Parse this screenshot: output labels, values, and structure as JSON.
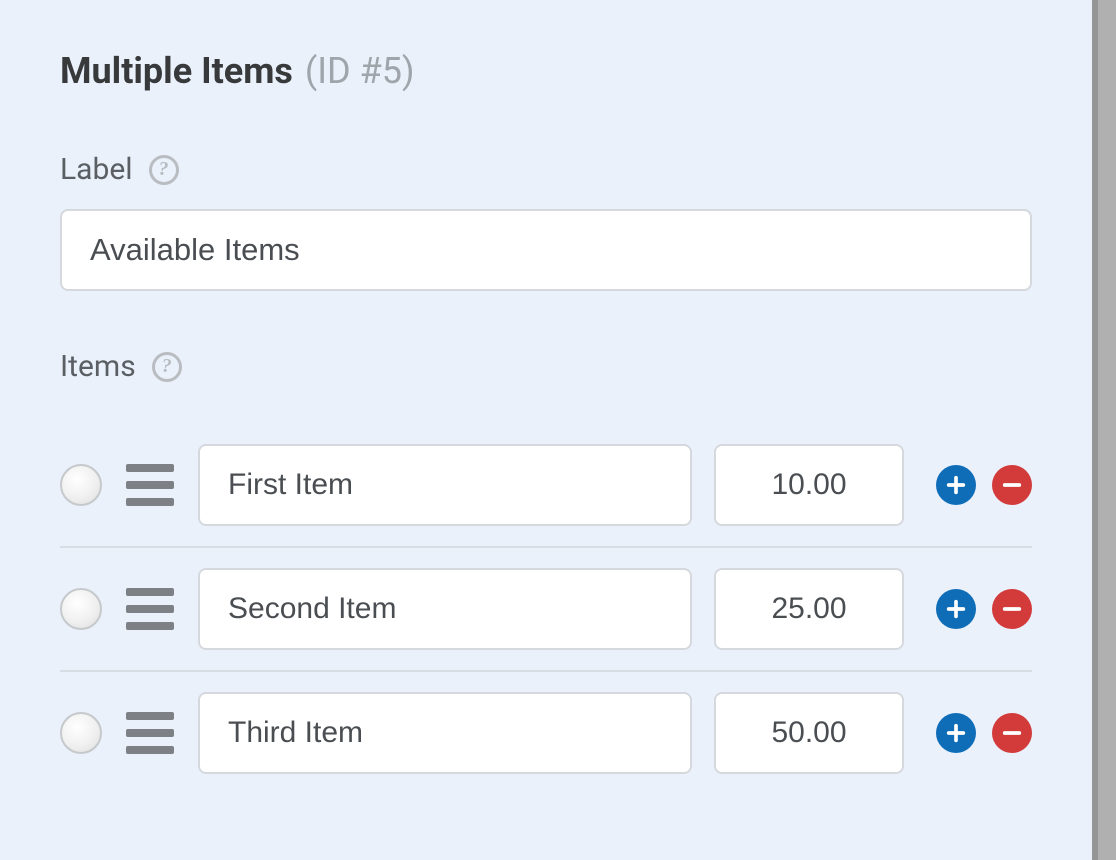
{
  "section": {
    "title": "Multiple Items",
    "id_label": "(ID #5)"
  },
  "label_field": {
    "label": "Label",
    "value": "Available Items"
  },
  "items_field": {
    "label": "Items",
    "rows": [
      {
        "name": "First Item",
        "price": "10.00"
      },
      {
        "name": "Second Item",
        "price": "25.00"
      },
      {
        "name": "Third Item",
        "price": "50.00"
      }
    ]
  }
}
